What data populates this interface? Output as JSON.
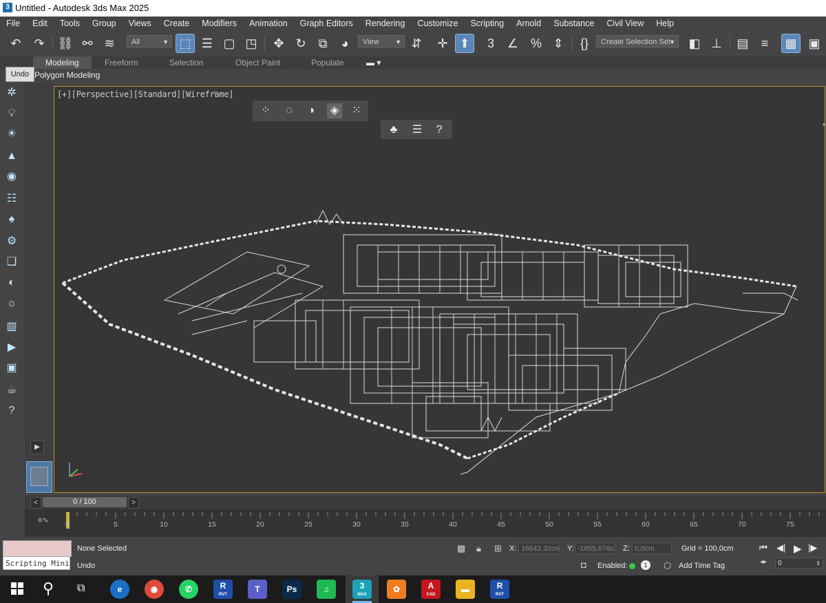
{
  "window": {
    "title": "Untitled - Autodesk 3ds Max 2025",
    "app_badge": "3"
  },
  "menu": [
    "File",
    "Edit",
    "Tools",
    "Group",
    "Views",
    "Create",
    "Modifiers",
    "Animation",
    "Graph Editors",
    "Rendering",
    "Customize",
    "Scripting",
    "Arnold",
    "Substance",
    "Civil View",
    "Help"
  ],
  "toolbar": {
    "filter_value": "All",
    "refcoord_value": "View",
    "selection_set_placeholder": "Create Selection Set"
  },
  "ribbon": {
    "tabs": [
      "Modeling",
      "Freeform",
      "Selection",
      "Object Paint",
      "Populate"
    ],
    "active_tab": "Modeling",
    "panel_label": "Polygon Modeling",
    "tooltip": "Undo"
  },
  "viewport": {
    "label": "[+][Perspective][Standard][Wireframe]"
  },
  "timeslider": {
    "position_text": "0 / 100",
    "prev": "<",
    "next": ">"
  },
  "trackbar": {
    "ticks": [
      "0",
      "5",
      "10",
      "15",
      "20",
      "25",
      "30",
      "35",
      "40",
      "45",
      "50",
      "55",
      "60",
      "65",
      "70",
      "75"
    ]
  },
  "status": {
    "selection": "None Selected",
    "prompt": "Undo",
    "x_label": "X:",
    "x_value": "16842,32cn",
    "y_label": "Y:",
    "y_value": "-1655,676c",
    "z_label": "Z:",
    "z_value": "0,0cm",
    "grid": "Grid = 100,0cm",
    "enabled_label": "Enabled:",
    "enabled_count": "1",
    "add_time_tag": "Add Time Tag",
    "frame_value": "0",
    "maxscript_placeholder": "Scripting Mini"
  },
  "taskbar": {
    "apps": [
      {
        "name": "revit-app-1",
        "label": "R",
        "sub": "RVT",
        "color": "#1f4fa8"
      },
      {
        "name": "teams-app",
        "label": "T",
        "color": "#5b5fc7"
      },
      {
        "name": "photoshop-app",
        "label": "Ps",
        "color": "#0a2a4a"
      },
      {
        "name": "spotify-app",
        "label": "♫",
        "color": "#1db954"
      },
      {
        "name": "3dsmax-app",
        "label": "3",
        "sub": "MAX",
        "color": "#1ba3b8"
      },
      {
        "name": "paint-app",
        "label": "✿",
        "color": "#f07c1e"
      },
      {
        "name": "autocad-app",
        "label": "A",
        "sub": "CAD",
        "color": "#c4161c"
      },
      {
        "name": "explorer-app",
        "label": "▬",
        "color": "#e8b423"
      },
      {
        "name": "revit-app-2",
        "label": "R",
        "sub": "RVT",
        "color": "#1f4fa8"
      }
    ]
  }
}
